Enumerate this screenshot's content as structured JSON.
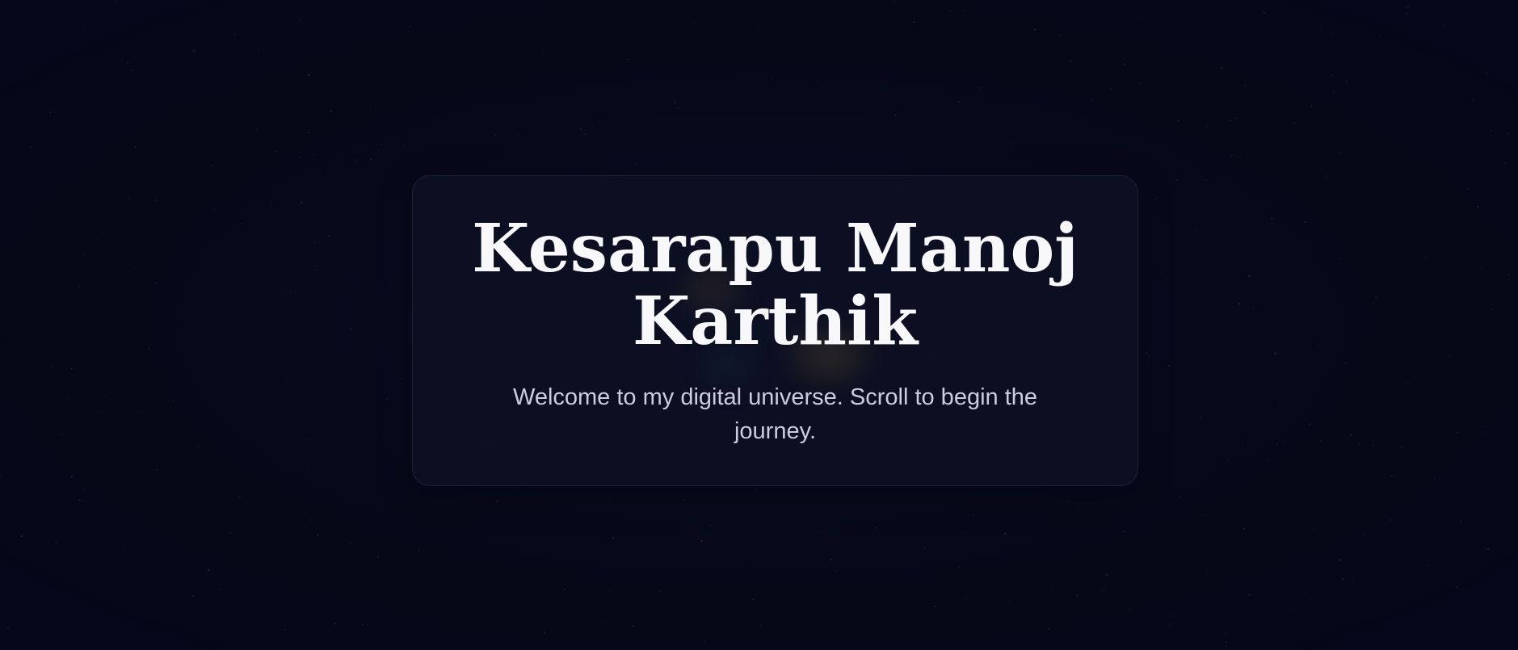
{
  "hero": {
    "title": "Kesarapu Manoj Karthik",
    "subtitle": "Welcome to my digital universe. Scroll to begin the journey."
  },
  "colors": {
    "background": "#060818",
    "card": "#0d1123",
    "title": "#f8f8fb",
    "subtitle": "#c9cddf",
    "glow": "#d2aa3c"
  }
}
